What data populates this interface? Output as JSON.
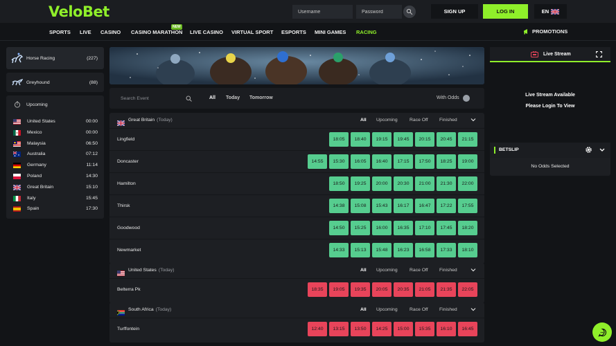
{
  "header": {
    "logo": "VeloBet",
    "username_placeholder": "Username",
    "password_placeholder": "Password",
    "signup": "SIGN UP",
    "login": "LOG IN",
    "language": "EN"
  },
  "nav": {
    "items": [
      "SPORTS",
      "LIVE",
      "CASINO",
      "CASINO MARATHON",
      "LIVE CASINO",
      "VIRTUAL SPORT",
      "ESPORTS",
      "MINI GAMES",
      "RACING"
    ],
    "new_badge": "NEW",
    "promotions": "PROMOTIONS"
  },
  "sidebar": {
    "sports": [
      {
        "label": "Horse Racing",
        "count": "(227)"
      },
      {
        "label": "Greyhound",
        "count": "(88)"
      }
    ],
    "upcoming_label": "Upcoming",
    "upcoming": [
      {
        "country": "United States",
        "time": "00:00",
        "flag": "us"
      },
      {
        "country": "Mexico",
        "time": "00:00",
        "flag": "mx"
      },
      {
        "country": "Malaysia",
        "time": "06:50",
        "flag": "my"
      },
      {
        "country": "Australia",
        "time": "07:12",
        "flag": "au"
      },
      {
        "country": "Germany",
        "time": "11:14",
        "flag": "de"
      },
      {
        "country": "Poland",
        "time": "14:30",
        "flag": "pl"
      },
      {
        "country": "Great Britain",
        "time": "15:10",
        "flag": "gb"
      },
      {
        "country": "Italy",
        "time": "15:45",
        "flag": "it"
      },
      {
        "country": "Spain",
        "time": "17:30",
        "flag": "es"
      }
    ]
  },
  "filter": {
    "search_placeholder": "Search Event",
    "tabs": [
      "All",
      "Today",
      "Tomorrow"
    ],
    "with_odds": "With Odds"
  },
  "section_tabs": [
    "All",
    "Upcoming",
    "Race Off",
    "Finished"
  ],
  "sections": [
    {
      "country": "Great Britain",
      "sub": "(Today)",
      "flag": "gb",
      "color": "green",
      "races": [
        {
          "track": "Lingfield",
          "times": [
            "18:05",
            "18:40",
            "19:15",
            "19:45",
            "20:15",
            "20:45",
            "21:15"
          ]
        },
        {
          "track": "Doncaster",
          "times": [
            "14:55",
            "15:30",
            "16:05",
            "16:40",
            "17:15",
            "17:50",
            "18:25",
            "19:00"
          ]
        },
        {
          "track": "Hamilton",
          "times": [
            "18:50",
            "19:25",
            "20:00",
            "20:30",
            "21:00",
            "21:30",
            "22:00"
          ]
        },
        {
          "track": "Thirsk",
          "times": [
            "14:38",
            "15:08",
            "15:43",
            "16:17",
            "16:47",
            "17:22",
            "17:55"
          ]
        },
        {
          "track": "Goodwood",
          "times": [
            "14:50",
            "15:25",
            "16:00",
            "16:35",
            "17:10",
            "17:45",
            "18:20"
          ]
        },
        {
          "track": "Newmarket",
          "times": [
            "14:33",
            "15:13",
            "15:48",
            "16:23",
            "16:58",
            "17:33",
            "18:10"
          ]
        }
      ]
    },
    {
      "country": "United States",
      "sub": "(Today)",
      "flag": "us",
      "color": "red",
      "races": [
        {
          "track": "Belterra Pk",
          "times": [
            "18:35",
            "19:05",
            "19:35",
            "20:05",
            "20:35",
            "21:05",
            "21:35",
            "22:05"
          ]
        }
      ]
    },
    {
      "country": "South Africa",
      "sub": "(Today)",
      "flag": "za",
      "color": "red",
      "races": [
        {
          "track": "Turffontein",
          "times": [
            "12:40",
            "13:15",
            "13:50",
            "14:25",
            "15:00",
            "15:35",
            "16:10",
            "16:45"
          ]
        }
      ]
    }
  ],
  "stream": {
    "title": "Live Stream",
    "msg1": "Live Stream Available",
    "msg2": "Please Login To View"
  },
  "betslip": {
    "title": "BETSLIP",
    "empty": "No Odds Selected"
  }
}
